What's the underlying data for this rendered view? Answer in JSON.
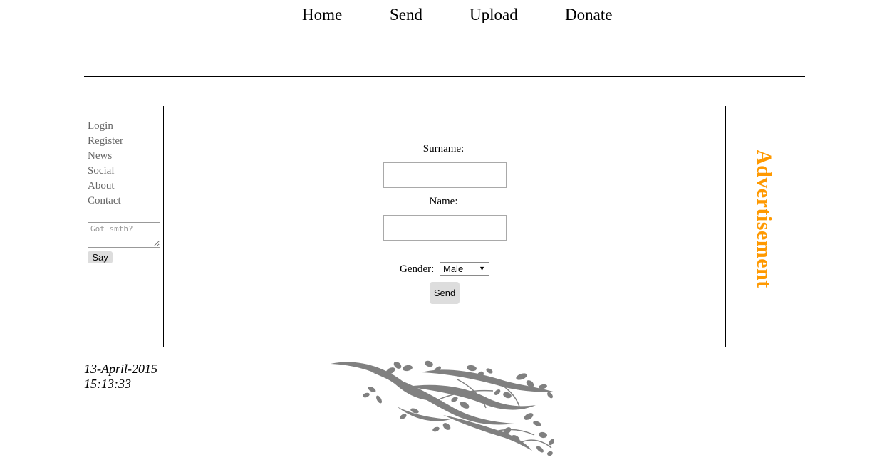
{
  "top_nav": {
    "items": [
      {
        "label": "Home"
      },
      {
        "label": "Send"
      },
      {
        "label": "Upload"
      },
      {
        "label": "Donate"
      }
    ]
  },
  "sidebar": {
    "links": [
      {
        "label": "Login"
      },
      {
        "label": "Register"
      },
      {
        "label": "News"
      },
      {
        "label": "Social"
      },
      {
        "label": "About"
      },
      {
        "label": "Contact"
      }
    ],
    "comment": {
      "placeholder": "Got smth?",
      "value": ""
    },
    "say_label": "Say"
  },
  "form": {
    "surname_label": "Surname:",
    "surname_value": "",
    "name_label": "Name:",
    "name_value": "",
    "gender_label": "Gender:",
    "gender_selected": "Male",
    "submit_label": "Send"
  },
  "advertisement": {
    "text": "Advertisement",
    "color": "#ff9900"
  },
  "footer": {
    "date": "13-April-2015",
    "time": "15:13:33"
  },
  "decoration": {
    "icon": "vine-branch-icon",
    "color": "#808080"
  }
}
